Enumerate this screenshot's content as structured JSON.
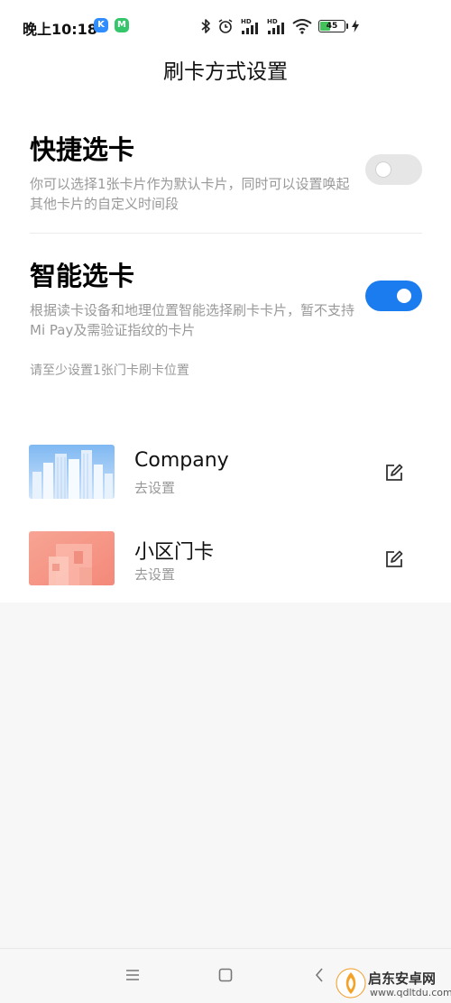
{
  "status_bar": {
    "time": "晚上10:18",
    "app_icons": [
      {
        "name": "k-app-icon",
        "letter": "K",
        "color": "#2f8dff"
      },
      {
        "name": "m-app-icon",
        "letter": "M",
        "color": "#35c66b"
      }
    ],
    "signal_label_1": "HD",
    "signal_label_2": "HD",
    "battery_level": 45,
    "battery_text": "45"
  },
  "page": {
    "title": "刷卡方式设置"
  },
  "quick_select": {
    "title": "快捷选卡",
    "description": "你可以选择1张卡片作为默认卡片，同时可以设置唤起其他卡片的自定义时间段",
    "enabled": false
  },
  "smart_select": {
    "title": "智能选卡",
    "description": "根据读卡设备和地理位置智能选择刷卡卡片，暂不支持Mi Pay及需验证指纹的卡片",
    "enabled": true,
    "hint": "请至少设置1张门卡刷卡位置"
  },
  "cards": [
    {
      "name": "Company",
      "subtitle": "去设置",
      "thumbnail": "city-buildings-thumbnail"
    },
    {
      "name": "小区门卡",
      "subtitle": "去设置",
      "thumbnail": "residence-thumbnail"
    }
  ],
  "colors": {
    "accent": "#1b7cf0",
    "toggle_off": "#e6e6e6",
    "secondary_text": "#999999"
  },
  "nav_bar": {
    "buttons": [
      "menu-icon",
      "home-icon",
      "back-icon"
    ]
  },
  "watermark": {
    "name": "启东安卓网",
    "url": "www.qdltdu.com"
  }
}
